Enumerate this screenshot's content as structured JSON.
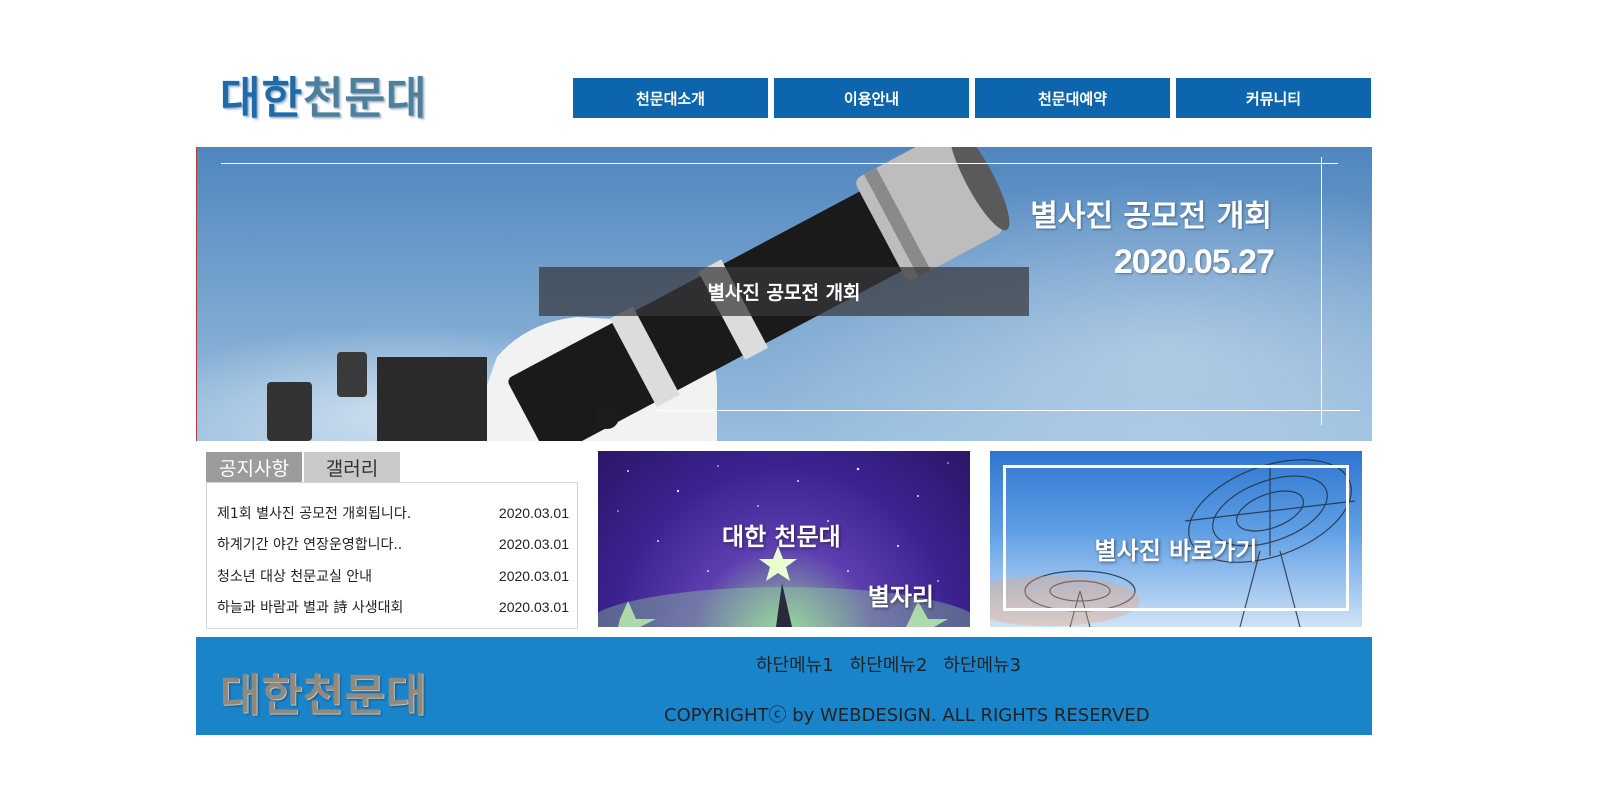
{
  "header": {
    "logo_part1": "대한",
    "logo_part2": "천문대",
    "menu": [
      "천문대소개",
      "이용안내",
      "천문대예약",
      "커뮤니티"
    ]
  },
  "slider": {
    "title": "별사진 공모전 개회",
    "date": "2020.05.27",
    "caption": "별사진 공모전 개회"
  },
  "notice": {
    "tabs": [
      "공지사항",
      "갤러리"
    ],
    "items": [
      {
        "title": "제1회 별사진 공모전 개회됩니다.",
        "date": "2020.03.01"
      },
      {
        "title": "하계기간 야간 연장운영합니다..",
        "date": "2020.03.01"
      },
      {
        "title": "청소년 대상 천문교실 안내",
        "date": "2020.03.01"
      },
      {
        "title": "하늘과 바람과 별과 詩 사생대회",
        "date": "2020.03.01"
      }
    ]
  },
  "banners": {
    "banner1_title": "대한 천문대",
    "banner1_sub": "별자리",
    "banner2_title": "별사진 바로가기"
  },
  "footer": {
    "logo": "대한천문대",
    "menu": [
      "하단메뉴1",
      "하단메뉴2",
      "하단메뉴3"
    ],
    "copyright": "COPYRIGHTⓒ by WEBDESIGN. ALL RIGHTS RESERVED"
  },
  "colors": {
    "primary": "#0c65ad",
    "footer_bg": "#1a84cb",
    "tab_active": "#9c9c9c",
    "tab_inactive": "#c9c9c9"
  }
}
